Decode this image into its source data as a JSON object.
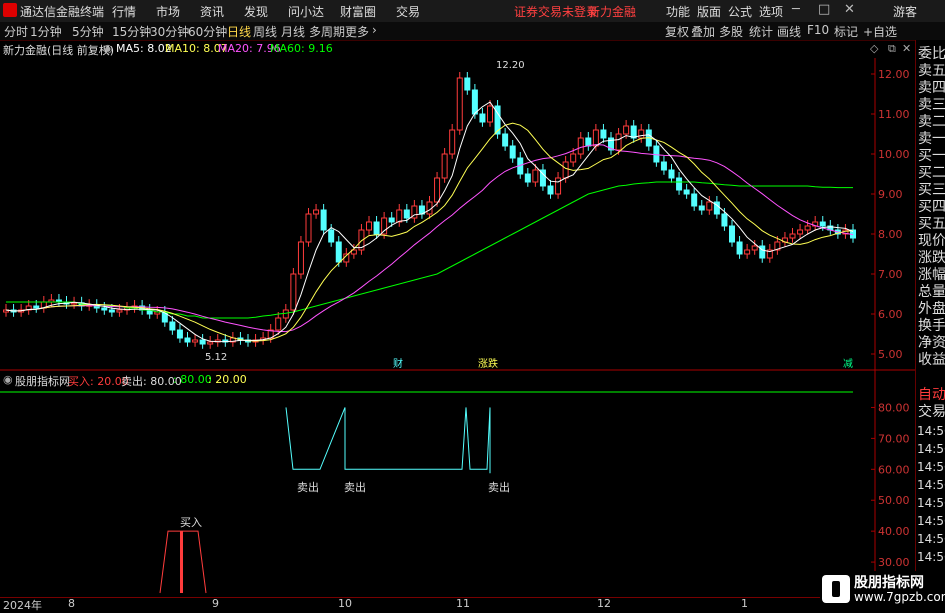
{
  "app": {
    "name": "通达信金融终端"
  },
  "menu": {
    "items": [
      "行情",
      "市场",
      "资讯",
      "发现",
      "问小达",
      "财富圈",
      "交易"
    ],
    "login_notice": "证券交易未登录",
    "brand": "新力金融",
    "right_items": [
      "功能",
      "版面",
      "公式",
      "选项"
    ],
    "guest": "游客"
  },
  "toolbar": {
    "periods": [
      "分时",
      "1分钟",
      "5分钟",
      "15分钟",
      "30分钟",
      "60分钟",
      "日线",
      "周线",
      "月线",
      "多周期",
      "更多"
    ],
    "active": "日线",
    "right_items": [
      "复权",
      "叠加",
      "多股",
      "统计",
      "画线",
      "F10",
      "标记",
      "+自选"
    ]
  },
  "info": {
    "stock_label": "新力金融(日线 前复权)",
    "ma5": "MA5: 8.02",
    "ma10": "MA10: 8.07",
    "ma20": "MA20: 7.96",
    "ma60": "MA60: 9.16"
  },
  "indicator": {
    "name": "股朋指标网",
    "buy": "买入: 20.00",
    "sell": "卖出: 80.00",
    "v1": ": 80.00",
    "v2": ": 20.00"
  },
  "side_panel": {
    "labels": [
      "委比",
      "卖五",
      "卖四",
      "卖三",
      "卖二",
      "卖一",
      "买一",
      "买二",
      "买三",
      "买四",
      "买五",
      "现价",
      "涨跌",
      "涨幅",
      "总量",
      "外盘",
      "换手",
      "净资",
      "收益"
    ],
    "auto": "自动",
    "trade": "交易",
    "times": [
      "14:56",
      "14:56",
      "14:56",
      "14:56",
      "14:56",
      "14:56",
      "14:56",
      "14:56"
    ]
  },
  "axis": {
    "price_ticks": [
      "12.00",
      "11.00",
      "10.00",
      "9.00",
      "8.00",
      "7.00",
      "6.00",
      "5.00"
    ],
    "ind_ticks": [
      "80.00",
      "70.00",
      "60.00",
      "50.00",
      "40.00",
      "30.00"
    ],
    "high_label": "12.20",
    "low_label": "5.12"
  },
  "markers": {
    "cai": "财",
    "zhang": "涨跌",
    "jian": "减",
    "sell": "卖出",
    "buy": "买入"
  },
  "dates": [
    "2024年",
    "8",
    "9",
    "10",
    "11",
    "12",
    "1"
  ],
  "watermark": {
    "name": "股朋指标网",
    "url": "www.7gpzb.com"
  },
  "colors": {
    "up": "#ff3c3c",
    "down": "#54ffff",
    "ma5": "#ffffff",
    "ma10": "#ffff54",
    "ma20": "#ff54ff",
    "ma60": "#00ff00",
    "axis": "#aa0000"
  },
  "chart_data": {
    "type": "candlestick",
    "ylim": [
      4.8,
      12.4
    ],
    "high": 12.2,
    "low": 5.12,
    "closes": [
      6.1,
      6.05,
      6.1,
      6.2,
      6.15,
      6.3,
      6.35,
      6.3,
      6.25,
      6.28,
      6.2,
      6.22,
      6.15,
      6.1,
      6.05,
      6.1,
      6.15,
      6.2,
      6.1,
      6.0,
      6.05,
      5.8,
      5.6,
      5.4,
      5.3,
      5.35,
      5.25,
      5.3,
      5.35,
      5.3,
      5.4,
      5.35,
      5.3,
      5.35,
      5.4,
      5.6,
      5.9,
      6.1,
      7.0,
      7.8,
      8.5,
      8.6,
      8.1,
      7.8,
      7.3,
      7.5,
      7.6,
      8.1,
      8.3,
      8.0,
      8.4,
      8.3,
      8.6,
      8.4,
      8.7,
      8.5,
      8.8,
      9.4,
      10.0,
      10.6,
      11.9,
      11.6,
      11.0,
      10.8,
      11.2,
      10.5,
      10.2,
      9.9,
      9.5,
      9.3,
      9.6,
      9.2,
      9.0,
      9.4,
      9.8,
      10.0,
      10.4,
      10.2,
      10.6,
      10.4,
      10.1,
      10.5,
      10.7,
      10.4,
      10.6,
      10.2,
      9.8,
      9.6,
      9.4,
      9.1,
      9.0,
      8.7,
      8.6,
      8.8,
      8.5,
      8.2,
      7.8,
      7.5,
      7.6,
      7.7,
      7.4,
      7.6,
      7.8,
      7.9,
      8.0,
      8.1,
      8.2,
      8.3,
      8.2,
      8.1,
      8.0,
      8.1,
      7.9
    ],
    "ma60": [
      6.3,
      6.3,
      6.3,
      6.3,
      6.3,
      6.3,
      6.3,
      6.3,
      6.3,
      6.3,
      6.25,
      6.25,
      6.2,
      6.2,
      6.2,
      6.2,
      6.15,
      6.15,
      6.1,
      6.1,
      6.05,
      6.05,
      6.0,
      6.0,
      5.95,
      5.95,
      5.9,
      5.9,
      5.9,
      5.9,
      5.9,
      5.9,
      5.9,
      5.92,
      5.95,
      5.97,
      6.0,
      6.02,
      6.05,
      6.1,
      6.15,
      6.2,
      6.25,
      6.3,
      6.35,
      6.4,
      6.45,
      6.5,
      6.55,
      6.6,
      6.65,
      6.7,
      6.75,
      6.8,
      6.85,
      6.9,
      6.95,
      7.0,
      7.1,
      7.2,
      7.3,
      7.4,
      7.5,
      7.6,
      7.7,
      7.8,
      7.9,
      8.0,
      8.1,
      8.2,
      8.3,
      8.4,
      8.5,
      8.6,
      8.7,
      8.8,
      8.9,
      9.0,
      9.05,
      9.1,
      9.15,
      9.2,
      9.22,
      9.25,
      9.27,
      9.28,
      9.3,
      9.3,
      9.3,
      9.3,
      9.3,
      9.3,
      9.28,
      9.27,
      9.25,
      9.23,
      9.22,
      9.2,
      9.2,
      9.2,
      9.2,
      9.2,
      9.2,
      9.2,
      9.2,
      9.2,
      9.2,
      9.18,
      9.17,
      9.17,
      9.16,
      9.16,
      9.16
    ]
  },
  "indicator_data": {
    "ylim": [
      20,
      85
    ],
    "sell_x_index": [
      30,
      36,
      52
    ],
    "buy_x_index": [
      18
    ],
    "line_level": 80
  }
}
